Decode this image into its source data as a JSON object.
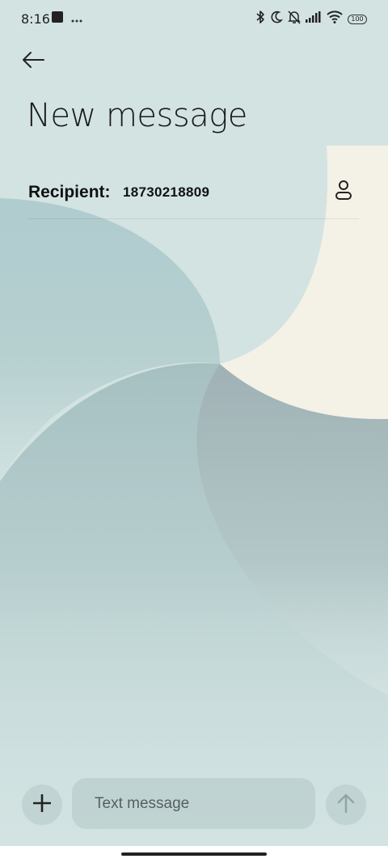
{
  "status_bar": {
    "time": "8:16",
    "battery_level": "100",
    "left_icons": [
      "app-notification-icon",
      "more-dots-icon"
    ],
    "right_icons": [
      "bluetooth-icon",
      "moon-icon",
      "bell-off-icon",
      "signal-icon",
      "wifi-icon",
      "battery-icon"
    ]
  },
  "header": {
    "title": "New message",
    "back_icon": "arrow-left-icon"
  },
  "recipient": {
    "label": "Recipient:",
    "value": "18730218809",
    "contact_icon": "person-icon"
  },
  "composer": {
    "placeholder": "Text message",
    "value": "",
    "attach_icon": "plus-icon",
    "send_icon": "arrow-up-icon"
  },
  "colors": {
    "background": "#d2e3e2",
    "accent_cream": "#f4f1e6",
    "wave_teal": "#b1cdd0",
    "wave_gray": "#9fb3b6",
    "text_primary": "#111111"
  }
}
